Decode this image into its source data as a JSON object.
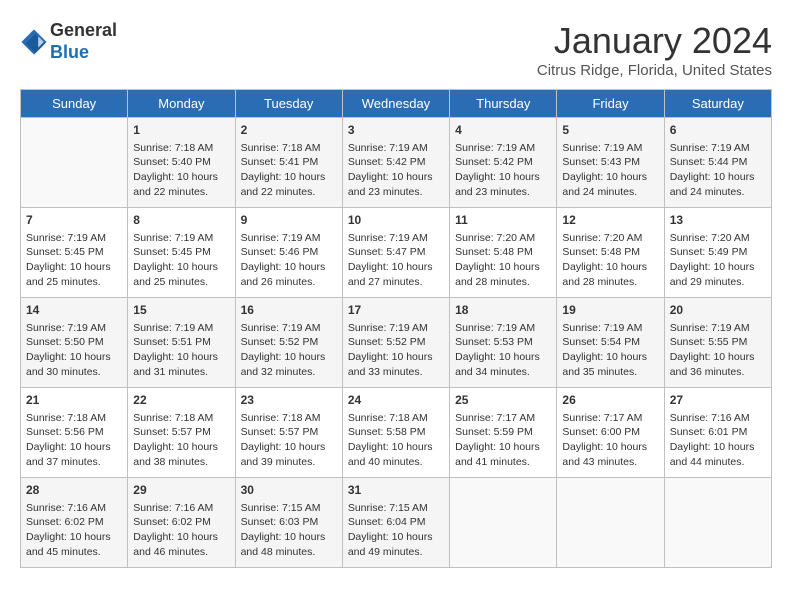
{
  "header": {
    "logo_line1": "General",
    "logo_line2": "Blue",
    "month_title": "January 2024",
    "location": "Citrus Ridge, Florida, United States"
  },
  "weekdays": [
    "Sunday",
    "Monday",
    "Tuesday",
    "Wednesday",
    "Thursday",
    "Friday",
    "Saturday"
  ],
  "weeks": [
    [
      {
        "num": "",
        "info": ""
      },
      {
        "num": "1",
        "info": "Sunrise: 7:18 AM\nSunset: 5:40 PM\nDaylight: 10 hours\nand 22 minutes."
      },
      {
        "num": "2",
        "info": "Sunrise: 7:18 AM\nSunset: 5:41 PM\nDaylight: 10 hours\nand 22 minutes."
      },
      {
        "num": "3",
        "info": "Sunrise: 7:19 AM\nSunset: 5:42 PM\nDaylight: 10 hours\nand 23 minutes."
      },
      {
        "num": "4",
        "info": "Sunrise: 7:19 AM\nSunset: 5:42 PM\nDaylight: 10 hours\nand 23 minutes."
      },
      {
        "num": "5",
        "info": "Sunrise: 7:19 AM\nSunset: 5:43 PM\nDaylight: 10 hours\nand 24 minutes."
      },
      {
        "num": "6",
        "info": "Sunrise: 7:19 AM\nSunset: 5:44 PM\nDaylight: 10 hours\nand 24 minutes."
      }
    ],
    [
      {
        "num": "7",
        "info": "Sunrise: 7:19 AM\nSunset: 5:45 PM\nDaylight: 10 hours\nand 25 minutes."
      },
      {
        "num": "8",
        "info": "Sunrise: 7:19 AM\nSunset: 5:45 PM\nDaylight: 10 hours\nand 25 minutes."
      },
      {
        "num": "9",
        "info": "Sunrise: 7:19 AM\nSunset: 5:46 PM\nDaylight: 10 hours\nand 26 minutes."
      },
      {
        "num": "10",
        "info": "Sunrise: 7:19 AM\nSunset: 5:47 PM\nDaylight: 10 hours\nand 27 minutes."
      },
      {
        "num": "11",
        "info": "Sunrise: 7:20 AM\nSunset: 5:48 PM\nDaylight: 10 hours\nand 28 minutes."
      },
      {
        "num": "12",
        "info": "Sunrise: 7:20 AM\nSunset: 5:48 PM\nDaylight: 10 hours\nand 28 minutes."
      },
      {
        "num": "13",
        "info": "Sunrise: 7:20 AM\nSunset: 5:49 PM\nDaylight: 10 hours\nand 29 minutes."
      }
    ],
    [
      {
        "num": "14",
        "info": "Sunrise: 7:19 AM\nSunset: 5:50 PM\nDaylight: 10 hours\nand 30 minutes."
      },
      {
        "num": "15",
        "info": "Sunrise: 7:19 AM\nSunset: 5:51 PM\nDaylight: 10 hours\nand 31 minutes."
      },
      {
        "num": "16",
        "info": "Sunrise: 7:19 AM\nSunset: 5:52 PM\nDaylight: 10 hours\nand 32 minutes."
      },
      {
        "num": "17",
        "info": "Sunrise: 7:19 AM\nSunset: 5:52 PM\nDaylight: 10 hours\nand 33 minutes."
      },
      {
        "num": "18",
        "info": "Sunrise: 7:19 AM\nSunset: 5:53 PM\nDaylight: 10 hours\nand 34 minutes."
      },
      {
        "num": "19",
        "info": "Sunrise: 7:19 AM\nSunset: 5:54 PM\nDaylight: 10 hours\nand 35 minutes."
      },
      {
        "num": "20",
        "info": "Sunrise: 7:19 AM\nSunset: 5:55 PM\nDaylight: 10 hours\nand 36 minutes."
      }
    ],
    [
      {
        "num": "21",
        "info": "Sunrise: 7:18 AM\nSunset: 5:56 PM\nDaylight: 10 hours\nand 37 minutes."
      },
      {
        "num": "22",
        "info": "Sunrise: 7:18 AM\nSunset: 5:57 PM\nDaylight: 10 hours\nand 38 minutes."
      },
      {
        "num": "23",
        "info": "Sunrise: 7:18 AM\nSunset: 5:57 PM\nDaylight: 10 hours\nand 39 minutes."
      },
      {
        "num": "24",
        "info": "Sunrise: 7:18 AM\nSunset: 5:58 PM\nDaylight: 10 hours\nand 40 minutes."
      },
      {
        "num": "25",
        "info": "Sunrise: 7:17 AM\nSunset: 5:59 PM\nDaylight: 10 hours\nand 41 minutes."
      },
      {
        "num": "26",
        "info": "Sunrise: 7:17 AM\nSunset: 6:00 PM\nDaylight: 10 hours\nand 43 minutes."
      },
      {
        "num": "27",
        "info": "Sunrise: 7:16 AM\nSunset: 6:01 PM\nDaylight: 10 hours\nand 44 minutes."
      }
    ],
    [
      {
        "num": "28",
        "info": "Sunrise: 7:16 AM\nSunset: 6:02 PM\nDaylight: 10 hours\nand 45 minutes."
      },
      {
        "num": "29",
        "info": "Sunrise: 7:16 AM\nSunset: 6:02 PM\nDaylight: 10 hours\nand 46 minutes."
      },
      {
        "num": "30",
        "info": "Sunrise: 7:15 AM\nSunset: 6:03 PM\nDaylight: 10 hours\nand 48 minutes."
      },
      {
        "num": "31",
        "info": "Sunrise: 7:15 AM\nSunset: 6:04 PM\nDaylight: 10 hours\nand 49 minutes."
      },
      {
        "num": "",
        "info": ""
      },
      {
        "num": "",
        "info": ""
      },
      {
        "num": "",
        "info": ""
      }
    ]
  ]
}
